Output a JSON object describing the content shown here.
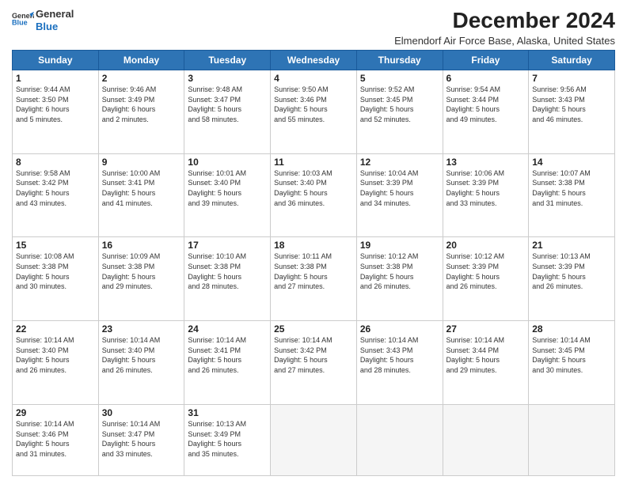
{
  "logo": {
    "line1": "General",
    "line2": "Blue"
  },
  "title": "December 2024",
  "subtitle": "Elmendorf Air Force Base, Alaska, United States",
  "days_of_week": [
    "Sunday",
    "Monday",
    "Tuesday",
    "Wednesday",
    "Thursday",
    "Friday",
    "Saturday"
  ],
  "weeks": [
    [
      {
        "day": "1",
        "info": "Sunrise: 9:44 AM\nSunset: 3:50 PM\nDaylight: 6 hours\nand 5 minutes."
      },
      {
        "day": "2",
        "info": "Sunrise: 9:46 AM\nSunset: 3:49 PM\nDaylight: 6 hours\nand 2 minutes."
      },
      {
        "day": "3",
        "info": "Sunrise: 9:48 AM\nSunset: 3:47 PM\nDaylight: 5 hours\nand 58 minutes."
      },
      {
        "day": "4",
        "info": "Sunrise: 9:50 AM\nSunset: 3:46 PM\nDaylight: 5 hours\nand 55 minutes."
      },
      {
        "day": "5",
        "info": "Sunrise: 9:52 AM\nSunset: 3:45 PM\nDaylight: 5 hours\nand 52 minutes."
      },
      {
        "day": "6",
        "info": "Sunrise: 9:54 AM\nSunset: 3:44 PM\nDaylight: 5 hours\nand 49 minutes."
      },
      {
        "day": "7",
        "info": "Sunrise: 9:56 AM\nSunset: 3:43 PM\nDaylight: 5 hours\nand 46 minutes."
      }
    ],
    [
      {
        "day": "8",
        "info": "Sunrise: 9:58 AM\nSunset: 3:42 PM\nDaylight: 5 hours\nand 43 minutes."
      },
      {
        "day": "9",
        "info": "Sunrise: 10:00 AM\nSunset: 3:41 PM\nDaylight: 5 hours\nand 41 minutes."
      },
      {
        "day": "10",
        "info": "Sunrise: 10:01 AM\nSunset: 3:40 PM\nDaylight: 5 hours\nand 39 minutes."
      },
      {
        "day": "11",
        "info": "Sunrise: 10:03 AM\nSunset: 3:40 PM\nDaylight: 5 hours\nand 36 minutes."
      },
      {
        "day": "12",
        "info": "Sunrise: 10:04 AM\nSunset: 3:39 PM\nDaylight: 5 hours\nand 34 minutes."
      },
      {
        "day": "13",
        "info": "Sunrise: 10:06 AM\nSunset: 3:39 PM\nDaylight: 5 hours\nand 33 minutes."
      },
      {
        "day": "14",
        "info": "Sunrise: 10:07 AM\nSunset: 3:38 PM\nDaylight: 5 hours\nand 31 minutes."
      }
    ],
    [
      {
        "day": "15",
        "info": "Sunrise: 10:08 AM\nSunset: 3:38 PM\nDaylight: 5 hours\nand 30 minutes."
      },
      {
        "day": "16",
        "info": "Sunrise: 10:09 AM\nSunset: 3:38 PM\nDaylight: 5 hours\nand 29 minutes."
      },
      {
        "day": "17",
        "info": "Sunrise: 10:10 AM\nSunset: 3:38 PM\nDaylight: 5 hours\nand 28 minutes."
      },
      {
        "day": "18",
        "info": "Sunrise: 10:11 AM\nSunset: 3:38 PM\nDaylight: 5 hours\nand 27 minutes."
      },
      {
        "day": "19",
        "info": "Sunrise: 10:12 AM\nSunset: 3:38 PM\nDaylight: 5 hours\nand 26 minutes."
      },
      {
        "day": "20",
        "info": "Sunrise: 10:12 AM\nSunset: 3:39 PM\nDaylight: 5 hours\nand 26 minutes."
      },
      {
        "day": "21",
        "info": "Sunrise: 10:13 AM\nSunset: 3:39 PM\nDaylight: 5 hours\nand 26 minutes."
      }
    ],
    [
      {
        "day": "22",
        "info": "Sunrise: 10:14 AM\nSunset: 3:40 PM\nDaylight: 5 hours\nand 26 minutes."
      },
      {
        "day": "23",
        "info": "Sunrise: 10:14 AM\nSunset: 3:40 PM\nDaylight: 5 hours\nand 26 minutes."
      },
      {
        "day": "24",
        "info": "Sunrise: 10:14 AM\nSunset: 3:41 PM\nDaylight: 5 hours\nand 26 minutes."
      },
      {
        "day": "25",
        "info": "Sunrise: 10:14 AM\nSunset: 3:42 PM\nDaylight: 5 hours\nand 27 minutes."
      },
      {
        "day": "26",
        "info": "Sunrise: 10:14 AM\nSunset: 3:43 PM\nDaylight: 5 hours\nand 28 minutes."
      },
      {
        "day": "27",
        "info": "Sunrise: 10:14 AM\nSunset: 3:44 PM\nDaylight: 5 hours\nand 29 minutes."
      },
      {
        "day": "28",
        "info": "Sunrise: 10:14 AM\nSunset: 3:45 PM\nDaylight: 5 hours\nand 30 minutes."
      }
    ],
    [
      {
        "day": "29",
        "info": "Sunrise: 10:14 AM\nSunset: 3:46 PM\nDaylight: 5 hours\nand 31 minutes."
      },
      {
        "day": "30",
        "info": "Sunrise: 10:14 AM\nSunset: 3:47 PM\nDaylight: 5 hours\nand 33 minutes."
      },
      {
        "day": "31",
        "info": "Sunrise: 10:13 AM\nSunset: 3:49 PM\nDaylight: 5 hours\nand 35 minutes."
      },
      null,
      null,
      null,
      null
    ]
  ]
}
